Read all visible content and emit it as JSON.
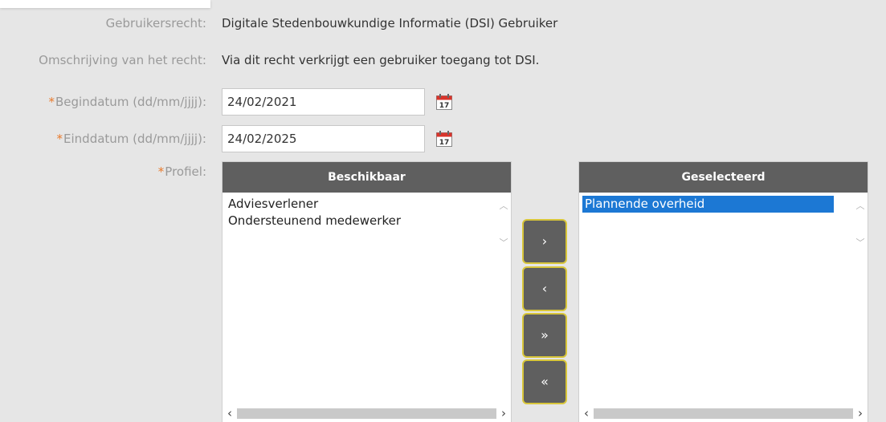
{
  "form": {
    "gebruikersrecht": {
      "label": "Gebruikersrecht:",
      "value": "Digitale Stedenbouwkundige Informatie (DSI) Gebruiker"
    },
    "omschrijving": {
      "label": "Omschrijving van het recht:",
      "value": "Via dit recht verkrijgt een gebruiker toegang tot DSI."
    },
    "begindatum": {
      "required_mark": "*",
      "label": "Begindatum (dd/mm/jjjj):",
      "value": "24/02/2021"
    },
    "einddatum": {
      "required_mark": "*",
      "label": "Einddatum (dd/mm/jjjj):",
      "value": "24/02/2025"
    },
    "profiel": {
      "required_mark": "*",
      "label": "Profiel:"
    }
  },
  "calendar_icon": {
    "day": "17",
    "icon": "calendar-icon"
  },
  "beschikbaar": {
    "title": "Beschikbaar",
    "items": [
      "Adviesverlener",
      "Ondersteunend medewerker"
    ]
  },
  "geselecteerd": {
    "title": "Geselecteerd",
    "items": [
      "Plannende overheid"
    ]
  },
  "move_buttons": {
    "add": "›",
    "remove": "‹",
    "add_all": "»",
    "remove_all": "«"
  },
  "colors": {
    "accent_required": "#e8792b",
    "header_bg": "#5f5f5f",
    "selection": "#1c78d4",
    "button_border": "#d8c63a"
  }
}
